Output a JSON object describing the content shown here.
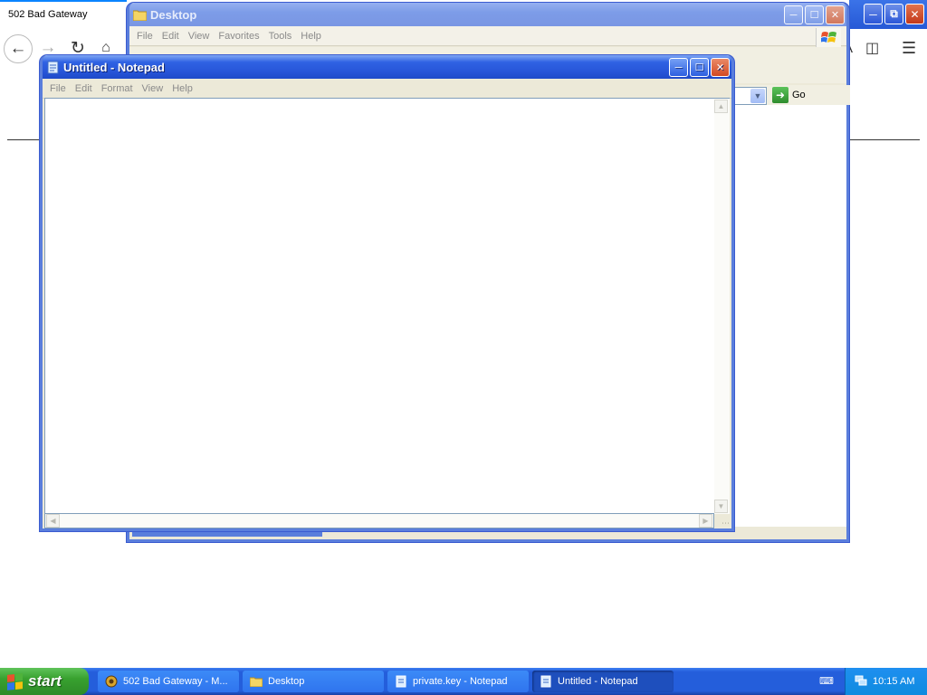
{
  "browser": {
    "tab_title": "502 Bad Gateway"
  },
  "explorer": {
    "title": "Desktop",
    "menu": [
      "File",
      "Edit",
      "View",
      "Favorites",
      "Tools",
      "Help"
    ],
    "go_label": "Go"
  },
  "notepad": {
    "title": "Untitled - Notepad",
    "menu": [
      "File",
      "Edit",
      "Format",
      "View",
      "Help"
    ],
    "content": ""
  },
  "taskbar": {
    "start_label": "start",
    "tasks": [
      {
        "label": "502 Bad Gateway - M..."
      },
      {
        "label": "Desktop"
      },
      {
        "label": "private.key - Notepad"
      },
      {
        "label": "Untitled - Notepad"
      }
    ],
    "clock": "10:15 AM"
  }
}
